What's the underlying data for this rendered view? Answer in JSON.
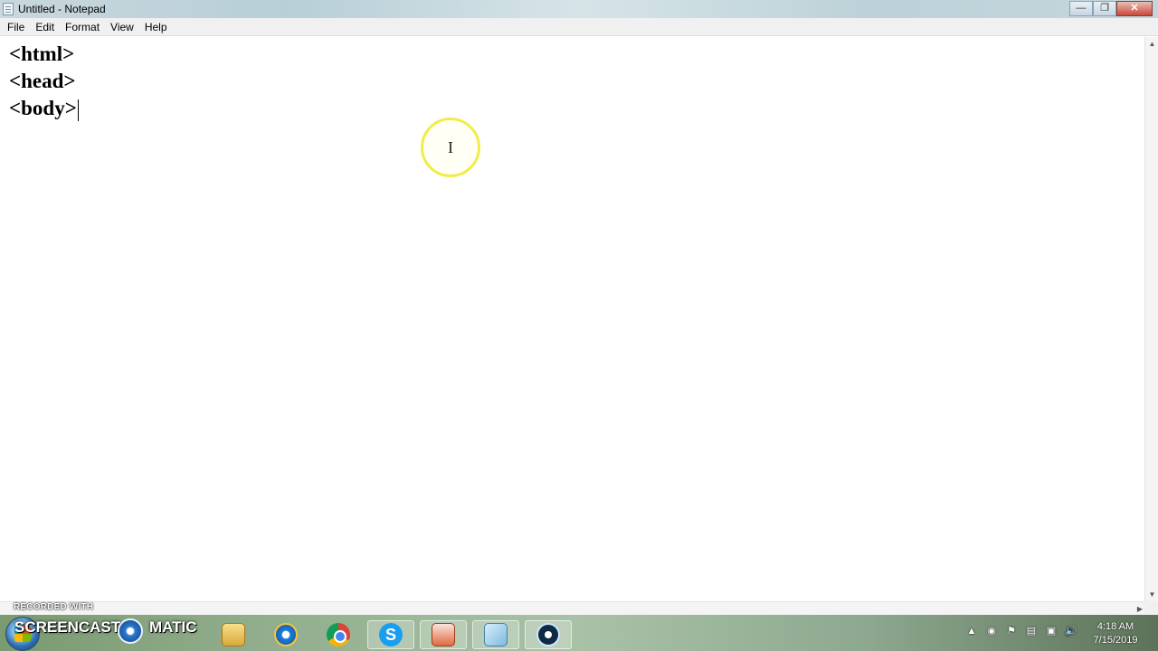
{
  "window": {
    "title": "Untitled - Notepad"
  },
  "menu": {
    "items": [
      "File",
      "Edit",
      "Format",
      "View",
      "Help"
    ]
  },
  "editor": {
    "lines": [
      "<html>",
      "<head>",
      "<body>"
    ]
  },
  "overlay": {
    "recorded_with": "RECORDED WITH",
    "brand_left": "SCREENCAST",
    "brand_right": "MATIC"
  },
  "taskbar": {
    "clock": {
      "time": "4:18 AM",
      "date": "7/15/2019"
    }
  },
  "colors": {
    "cursor_highlight": "#f1ec49",
    "close_button": "#c9483a"
  }
}
